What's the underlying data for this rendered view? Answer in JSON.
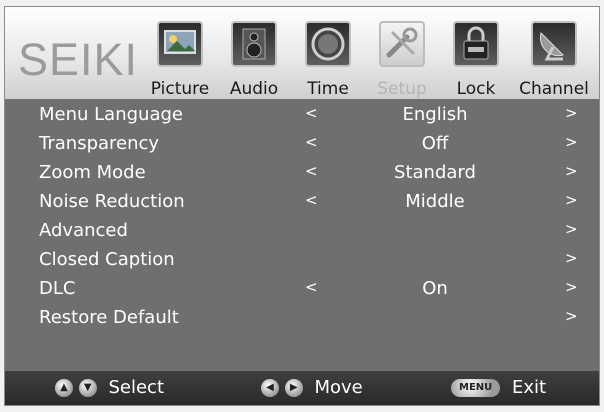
{
  "brand": {
    "logo": "SEIKI"
  },
  "tabs": [
    {
      "label": "Picture",
      "icon": "picture-icon",
      "active": false
    },
    {
      "label": "Audio",
      "icon": "audio-icon",
      "active": false
    },
    {
      "label": "Time",
      "icon": "clock-icon",
      "active": false
    },
    {
      "label": "Setup",
      "icon": "setup-icon",
      "active": true
    },
    {
      "label": "Lock",
      "icon": "lock-icon",
      "active": false
    },
    {
      "label": "Channel",
      "icon": "satellite-dish-icon",
      "active": false
    }
  ],
  "menu": {
    "items": [
      {
        "label": "Menu Language",
        "left_arrow": "<",
        "value": "English",
        "right_arrow": ">"
      },
      {
        "label": "Transparency",
        "left_arrow": "<",
        "value": "Off",
        "right_arrow": ">"
      },
      {
        "label": "Zoom Mode",
        "left_arrow": "<",
        "value": "Standard",
        "right_arrow": ">"
      },
      {
        "label": "Noise Reduction",
        "left_arrow": "<",
        "value": "Middle",
        "right_arrow": ">"
      },
      {
        "label": "Advanced",
        "left_arrow": "",
        "value": "",
        "right_arrow": ">"
      },
      {
        "label": "Closed Caption",
        "left_arrow": "",
        "value": "",
        "right_arrow": ">"
      },
      {
        "label": "DLC",
        "left_arrow": "<",
        "value": "On",
        "right_arrow": ">"
      },
      {
        "label": "Restore Default",
        "left_arrow": "",
        "value": "",
        "right_arrow": ">"
      }
    ]
  },
  "footer": {
    "select_label": "Select",
    "move_label": "Move",
    "menu_button": "MENU",
    "exit_label": "Exit"
  }
}
